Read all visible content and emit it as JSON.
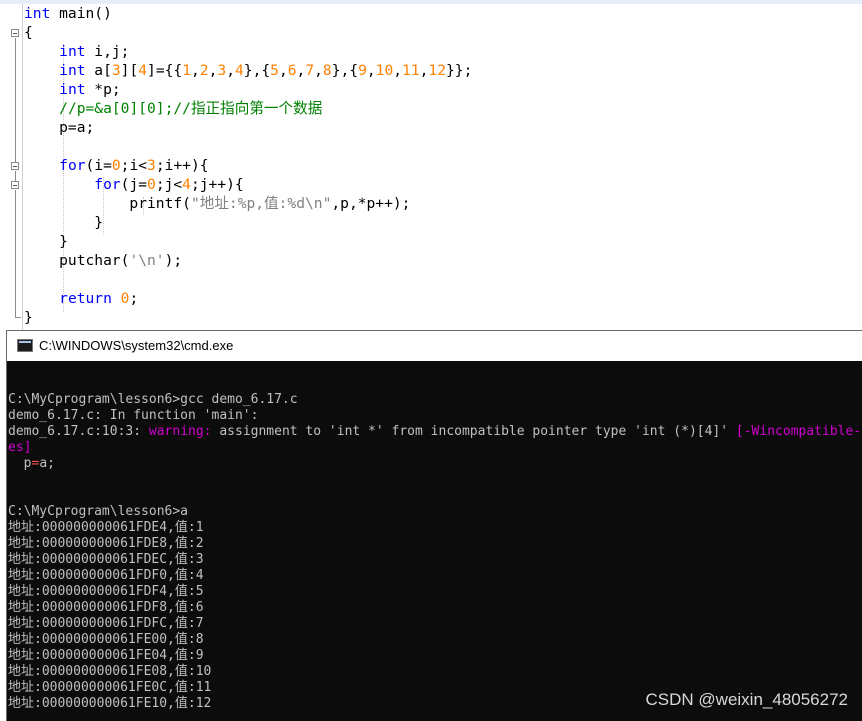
{
  "editor": {
    "lines": [
      [
        [
          "kw",
          "int"
        ],
        [
          "txt",
          " main()"
        ]
      ],
      [
        [
          "txt",
          "{"
        ]
      ],
      [
        [
          "txt",
          "    "
        ],
        [
          "kw",
          "int"
        ],
        [
          "txt",
          " i,j;"
        ]
      ],
      [
        [
          "txt",
          "    "
        ],
        [
          "kw",
          "int"
        ],
        [
          "txt",
          " a["
        ],
        [
          "num",
          "3"
        ],
        [
          "txt",
          "]["
        ],
        [
          "num",
          "4"
        ],
        [
          "txt",
          "]={{"
        ],
        [
          "num",
          "1"
        ],
        [
          "txt",
          ","
        ],
        [
          "num",
          "2"
        ],
        [
          "txt",
          ","
        ],
        [
          "num",
          "3"
        ],
        [
          "txt",
          ","
        ],
        [
          "num",
          "4"
        ],
        [
          "txt",
          "},{"
        ],
        [
          "num",
          "5"
        ],
        [
          "txt",
          ","
        ],
        [
          "num",
          "6"
        ],
        [
          "txt",
          ","
        ],
        [
          "num",
          "7"
        ],
        [
          "txt",
          ","
        ],
        [
          "num",
          "8"
        ],
        [
          "txt",
          "},{"
        ],
        [
          "num",
          "9"
        ],
        [
          "txt",
          ","
        ],
        [
          "num",
          "10"
        ],
        [
          "txt",
          ","
        ],
        [
          "num",
          "11"
        ],
        [
          "txt",
          ","
        ],
        [
          "num",
          "12"
        ],
        [
          "txt",
          "}};"
        ]
      ],
      [
        [
          "txt",
          "    "
        ],
        [
          "kw",
          "int"
        ],
        [
          "txt",
          " *p;"
        ]
      ],
      [
        [
          "txt",
          "    "
        ],
        [
          "cmt",
          "//p=&a[0][0];//指正指向第一个数据"
        ]
      ],
      [
        [
          "txt",
          "    p=a;"
        ]
      ],
      [
        [
          "txt",
          ""
        ]
      ],
      [
        [
          "txt",
          "    "
        ],
        [
          "kw",
          "for"
        ],
        [
          "txt",
          "(i="
        ],
        [
          "num",
          "0"
        ],
        [
          "txt",
          ";i<"
        ],
        [
          "num",
          "3"
        ],
        [
          "txt",
          ";i++){"
        ]
      ],
      [
        [
          "txt",
          "        "
        ],
        [
          "kw",
          "for"
        ],
        [
          "txt",
          "(j="
        ],
        [
          "num",
          "0"
        ],
        [
          "txt",
          ";j<"
        ],
        [
          "num",
          "4"
        ],
        [
          "txt",
          ";j++){"
        ]
      ],
      [
        [
          "txt",
          "            printf("
        ],
        [
          "str",
          "\"地址:%p,值:%d\\n\""
        ],
        [
          "txt",
          ",p,*p++);"
        ]
      ],
      [
        [
          "txt",
          "        }"
        ]
      ],
      [
        [
          "txt",
          "    }"
        ]
      ],
      [
        [
          "txt",
          "    putchar("
        ],
        [
          "str",
          "'\\n'"
        ],
        [
          "txt",
          ");"
        ]
      ],
      [
        [
          "txt",
          ""
        ]
      ],
      [
        [
          "txt",
          "    "
        ],
        [
          "kw",
          "return"
        ],
        [
          "txt",
          " "
        ],
        [
          "num",
          "0"
        ],
        [
          "txt",
          ";"
        ]
      ],
      [
        [
          "txt",
          "}"
        ]
      ]
    ]
  },
  "cmd_window": {
    "title": "C:\\WINDOWS\\system32\\cmd.exe",
    "console_lines": [
      [
        [
          "n",
          ""
        ]
      ],
      [
        [
          "n",
          "C:\\MyCprogram\\lesson6>gcc demo_6.17.c"
        ]
      ],
      [
        [
          "n",
          "demo_6.17.c: In function 'main':"
        ]
      ],
      [
        [
          "n",
          "demo_6.17.c:10:3: "
        ],
        [
          "w",
          "warning:"
        ],
        [
          "n",
          " assignment to 'int *' from incompatible pointer type 'int (*)[4]' "
        ],
        [
          "w",
          "[-Wincompatible-pointer-types]"
        ]
      ],
      [
        [
          "w",
          "es]"
        ]
      ],
      [
        [
          "n",
          "  p"
        ],
        [
          "t",
          "="
        ],
        [
          "n",
          "a;"
        ]
      ],
      [
        [
          "n",
          ""
        ]
      ],
      [
        [
          "n",
          ""
        ]
      ],
      [
        [
          "n",
          "C:\\MyCprogram\\lesson6>a"
        ]
      ],
      [
        [
          "n",
          "地址:000000000061FDE4,值:1"
        ]
      ],
      [
        [
          "n",
          "地址:000000000061FDE8,值:2"
        ]
      ],
      [
        [
          "n",
          "地址:000000000061FDEC,值:3"
        ]
      ],
      [
        [
          "n",
          "地址:000000000061FDF0,值:4"
        ]
      ],
      [
        [
          "n",
          "地址:000000000061FDF4,值:5"
        ]
      ],
      [
        [
          "n",
          "地址:000000000061FDF8,值:6"
        ]
      ],
      [
        [
          "n",
          "地址:000000000061FDFC,值:7"
        ]
      ],
      [
        [
          "n",
          "地址:000000000061FE00,值:8"
        ]
      ],
      [
        [
          "n",
          "地址:000000000061FE04,值:9"
        ]
      ],
      [
        [
          "n",
          "地址:000000000061FE08,值:10"
        ]
      ],
      [
        [
          "n",
          "地址:000000000061FE0C,值:11"
        ]
      ],
      [
        [
          "n",
          "地址:000000000061FE10,值:12"
        ]
      ]
    ]
  },
  "watermark": "CSDN @weixin_48056272",
  "colors": {
    "keyword": "#0000ff",
    "number": "#ff8000",
    "comment": "#008000",
    "string": "#808080",
    "console_text": "#c0c0c0",
    "console_bg": "#0c0c0c",
    "warning": "#d000d0"
  }
}
